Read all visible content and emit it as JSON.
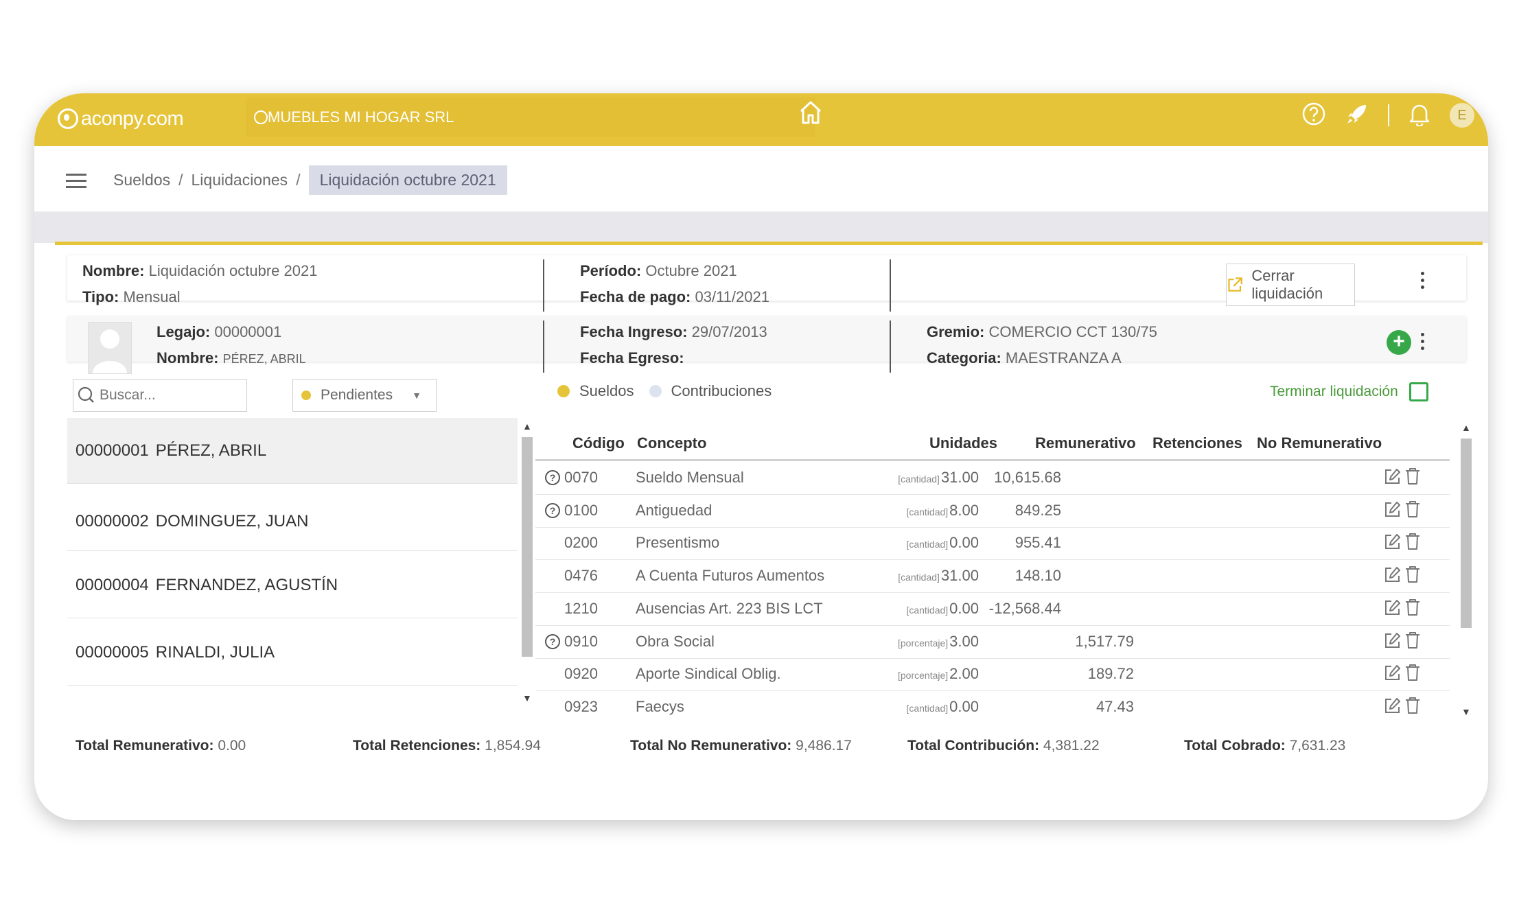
{
  "app": {
    "logo": "aconpy.com",
    "company": "MUEBLES MI HOGAR SRL",
    "avatar_letter": "E"
  },
  "breadcrumb": {
    "items": [
      "Sueldos",
      "Liquidaciones"
    ],
    "current": "Liquidación octubre 2021"
  },
  "liquidacion": {
    "nombre_label": "Nombre:",
    "nombre": "Liquidación octubre 2021",
    "tipo_label": "Tipo:",
    "tipo": "Mensual",
    "periodo_label": "Período:",
    "periodo": "Octubre 2021",
    "fecha_pago_label": "Fecha de pago:",
    "fecha_pago": "03/11/2021",
    "cerrar_label": "Cerrar liquidación"
  },
  "empleado": {
    "legajo_label": "Legajo:",
    "legajo": "00000001",
    "nombre_label": "Nombre:",
    "nombre": "PÉREZ, ABRIL",
    "fecha_ingreso_label": "Fecha Ingreso:",
    "fecha_ingreso": "29/07/2013",
    "fecha_egreso_label": "Fecha Egreso:",
    "fecha_egreso": "",
    "gremio_label": "Gremio:",
    "gremio": "COMERCIO CCT 130/75",
    "categoria_label": "Categoria:",
    "categoria": "MAESTRANZA A"
  },
  "filters": {
    "search_placeholder": "Buscar...",
    "status": "Pendientes",
    "legend_sueldos": "Sueldos",
    "legend_contribuciones": "Contribuciones",
    "terminar_label": "Terminar liquidación"
  },
  "employees": [
    {
      "code": "00000001",
      "name": "PÉREZ, ABRIL"
    },
    {
      "code": "00000002",
      "name": "DOMINGUEZ, JUAN"
    },
    {
      "code": "00000004",
      "name": "FERNANDEZ, AGUSTÍN"
    },
    {
      "code": "00000005",
      "name": "RINALDI, JULIA"
    }
  ],
  "table": {
    "headers": {
      "codigo": "Código",
      "concepto": "Concepto",
      "unidades": "Unidades",
      "remunerativo": "Remunerativo",
      "retenciones": "Retenciones",
      "no_remunerativo": "No Remunerativo"
    },
    "rows": [
      {
        "help": true,
        "codigo": "0070",
        "concepto": "Sueldo Mensual",
        "unit_type": "[cantidad]",
        "unidades": "31.00",
        "remunerativo": "10,615.68",
        "retenciones": "",
        "no_remunerativo": ""
      },
      {
        "help": true,
        "codigo": "0100",
        "concepto": "Antiguedad",
        "unit_type": "[cantidad]",
        "unidades": "8.00",
        "remunerativo": "849.25",
        "retenciones": "",
        "no_remunerativo": ""
      },
      {
        "help": false,
        "codigo": "0200",
        "concepto": "Presentismo",
        "unit_type": "[cantidad]",
        "unidades": "0.00",
        "remunerativo": "955.41",
        "retenciones": "",
        "no_remunerativo": ""
      },
      {
        "help": false,
        "codigo": "0476",
        "concepto": "A Cuenta Futuros Aumentos",
        "unit_type": "[cantidad]",
        "unidades": "31.00",
        "remunerativo": "148.10",
        "retenciones": "",
        "no_remunerativo": ""
      },
      {
        "help": false,
        "codigo": "1210",
        "concepto": "Ausencias Art. 223 BIS LCT",
        "unit_type": "[cantidad]",
        "unidades": "0.00",
        "remunerativo": "-12,568.44",
        "retenciones": "",
        "no_remunerativo": ""
      },
      {
        "help": true,
        "codigo": "0910",
        "concepto": "Obra Social",
        "unit_type": "[porcentaje]",
        "unidades": "3.00",
        "remunerativo": "",
        "retenciones": "1,517.79",
        "no_remunerativo": ""
      },
      {
        "help": false,
        "codigo": "0920",
        "concepto": "Aporte Sindical Oblig.",
        "unit_type": "[porcentaje]",
        "unidades": "2.00",
        "remunerativo": "",
        "retenciones": "189.72",
        "no_remunerativo": ""
      },
      {
        "help": false,
        "codigo": "0923",
        "concepto": "Faecys",
        "unit_type": "[cantidad]",
        "unidades": "0.00",
        "remunerativo": "",
        "retenciones": "47.43",
        "no_remunerativo": ""
      }
    ]
  },
  "totals": {
    "remunerativo_label": "Total Remunerativo:",
    "remunerativo": "0.00",
    "retenciones_label": "Total Retenciones:",
    "retenciones": "1,854.94",
    "no_remunerativo_label": "Total No Remunerativo:",
    "no_remunerativo": "9,486.17",
    "contribucion_label": "Total Contribución:",
    "contribucion": "4,381.22",
    "cobrado_label": "Total Cobrado:",
    "cobrado": "7,631.23"
  },
  "colors": {
    "brand": "#e6c43a",
    "accent_green": "#36a84a",
    "contribuciones_dot": "#dde3ee"
  }
}
